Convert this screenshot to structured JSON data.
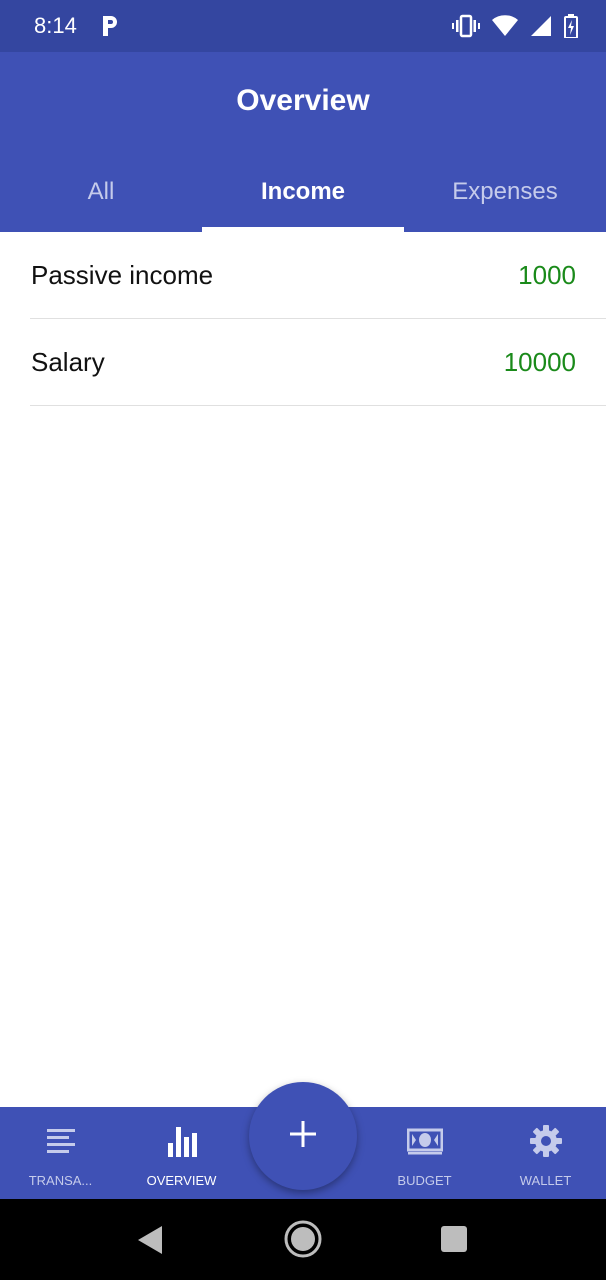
{
  "status_bar": {
    "time": "8:14",
    "icons": [
      "parking-app-icon",
      "vibrate-icon",
      "wifi-icon",
      "signal-icon",
      "battery-icon"
    ]
  },
  "app_bar": {
    "title": "Overview"
  },
  "tabs": [
    {
      "label": "All",
      "active": false
    },
    {
      "label": "Income",
      "active": true
    },
    {
      "label": "Expenses",
      "active": false
    }
  ],
  "income_list": [
    {
      "name": "Passive income",
      "amount": "1000"
    },
    {
      "name": "Salary",
      "amount": "10000"
    }
  ],
  "bottom_nav": {
    "items": [
      {
        "label": "TRANSA...",
        "icon": "transactions-list-icon",
        "active": false
      },
      {
        "label": "OVERVIEW",
        "icon": "bar-chart-icon",
        "active": true
      },
      {
        "label": "BUDGET",
        "icon": "money-icon",
        "active": false
      },
      {
        "label": "WALLET",
        "icon": "gear-icon",
        "active": false
      }
    ],
    "fab_icon": "plus-icon"
  },
  "colors": {
    "primary": "#3f51b5",
    "primary_dark": "#3446a0",
    "income_green": "#1a8a1a",
    "inactive_tab": "#c5cbeb"
  }
}
